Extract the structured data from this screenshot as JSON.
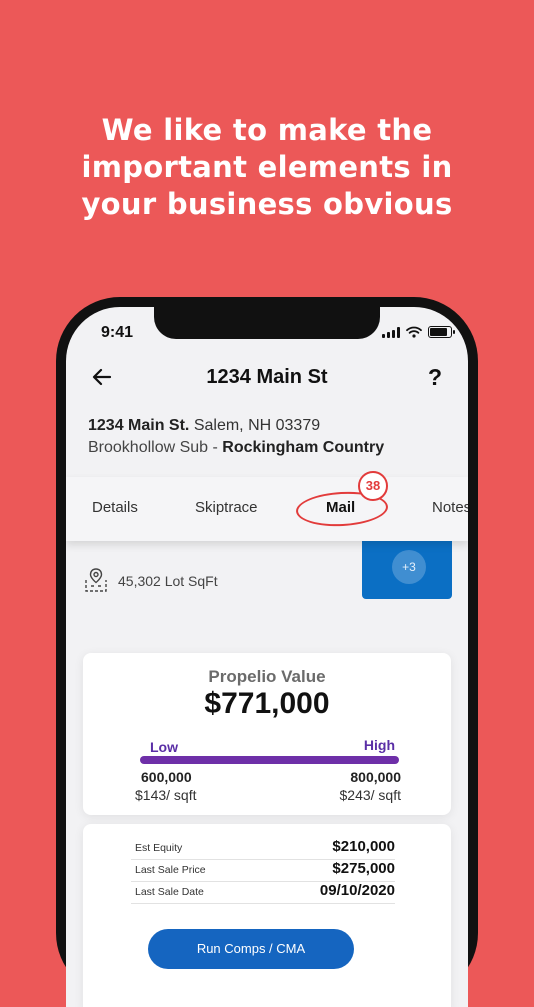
{
  "headline": {
    "line1": "We like to make the",
    "line2": "important elements in",
    "line3": "your business obvious"
  },
  "status_bar": {
    "time": "9:41"
  },
  "header": {
    "title": "1234 Main St",
    "help_label": "?"
  },
  "address": {
    "street": "1234 Main St.",
    "city_state": "Salem, NH 03379",
    "subdivision": "Brookhollow Sub -",
    "county": "Rockingham Country"
  },
  "tabs": {
    "details": "Details",
    "skiptrace": "Skiptrace",
    "mail": "Mail",
    "mail_badge": "38",
    "notes": "Notes"
  },
  "property": {
    "lot": "45,302 Lot SqFt",
    "more_photos": "+3"
  },
  "valuation": {
    "title": "Propelio Value",
    "value": "$771,000",
    "low_label": "Low",
    "high_label": "High",
    "low_amount": "600,000",
    "low_per_sqft": "$143/ sqft",
    "high_amount": "800,000",
    "high_per_sqft": "$243/ sqft"
  },
  "stats": [
    {
      "label": "Est Equity",
      "value": "$210,000"
    },
    {
      "label": "Last Sale Price",
      "value": "$275,000"
    },
    {
      "label": "Last Sale Date",
      "value": "09/10/2020"
    }
  ],
  "cta_label": "Run Comps / CMA",
  "colors": {
    "background": "#ec5858",
    "accent_purple": "#6e2fa8",
    "accent_blue": "#1565c0",
    "highlight_red": "#e23b3b"
  }
}
